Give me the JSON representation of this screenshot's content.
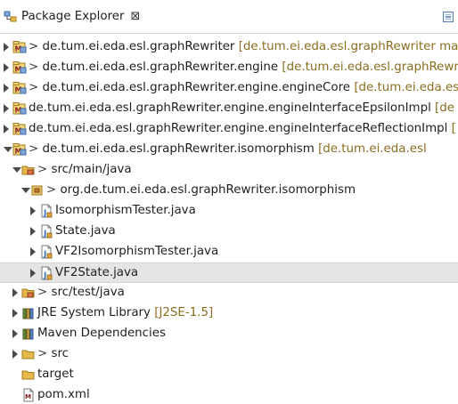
{
  "view": {
    "title": "Package Explorer",
    "close_glyph": "⊠",
    "collapse_icon": "collapse-all-icon"
  },
  "tree": [
    {
      "kind": "project",
      "arrow": "right",
      "prefix": "> ",
      "label": "de.tum.ei.eda.esl.graphRewriter",
      "deco": "[de.tum.ei.eda.esl.graphRewriter ma",
      "icon": "maven-project-icon"
    },
    {
      "kind": "project",
      "arrow": "right",
      "prefix": "> ",
      "label": "de.tum.ei.eda.esl.graphRewriter.engine",
      "deco": "[de.tum.ei.eda.esl.graphRewri",
      "icon": "maven-project-icon"
    },
    {
      "kind": "project",
      "arrow": "right",
      "prefix": "> ",
      "label": "de.tum.ei.eda.esl.graphRewriter.engine.engineCore",
      "deco": "[de.tum.ei.eda.esl",
      "icon": "maven-project-icon"
    },
    {
      "kind": "project",
      "arrow": "right",
      "prefix": "",
      "label": "de.tum.ei.eda.esl.graphRewriter.engine.engineInterfaceEpsilonImpl",
      "deco": "[de",
      "icon": "maven-project-icon"
    },
    {
      "kind": "project",
      "arrow": "right",
      "prefix": "",
      "label": "de.tum.ei.eda.esl.graphRewriter.engine.engineInterfaceReflectionImpl",
      "deco": "[",
      "icon": "maven-project-icon"
    },
    {
      "kind": "project",
      "arrow": "down",
      "prefix": "> ",
      "label": "de.tum.ei.eda.esl.graphRewriter.isomorphism",
      "deco": "[de.tum.ei.eda.esl",
      "icon": "maven-project-icon"
    },
    {
      "kind": "source-folder",
      "arrow": "down",
      "prefix": "> ",
      "label": "src/main/java",
      "deco": "",
      "icon": "source-folder-icon"
    },
    {
      "kind": "package",
      "arrow": "down",
      "prefix": "> ",
      "label": "org.de.tum.ei.eda.esl.graphRewriter.isomorphism",
      "deco": "",
      "icon": "package-icon"
    },
    {
      "kind": "file",
      "arrow": "right",
      "prefix": "",
      "label": "IsomorphismTester.java",
      "deco": "",
      "icon": "java-file-icon"
    },
    {
      "kind": "file",
      "arrow": "right",
      "prefix": "",
      "label": "State.java",
      "deco": "",
      "icon": "java-file-icon"
    },
    {
      "kind": "file",
      "arrow": "right",
      "prefix": "",
      "label": "VF2IsomorphismTester.java",
      "deco": "",
      "icon": "java-file-icon"
    },
    {
      "kind": "file",
      "arrow": "right",
      "prefix": "",
      "label": "VF2State.java",
      "deco": "",
      "icon": "java-file-icon",
      "selected": true
    },
    {
      "kind": "source-folder",
      "arrow": "right",
      "prefix": "> ",
      "label": "src/test/java",
      "deco": "",
      "icon": "source-folder-icon"
    },
    {
      "kind": "library",
      "arrow": "right",
      "prefix": "",
      "label": "JRE System Library",
      "deco": "[J2SE-1.5]",
      "icon": "library-icon"
    },
    {
      "kind": "library",
      "arrow": "right",
      "prefix": "",
      "label": "Maven Dependencies",
      "deco": "",
      "icon": "library-icon"
    },
    {
      "kind": "folder",
      "arrow": "right",
      "prefix": "> ",
      "label": "src",
      "deco": "",
      "icon": "folder-icon"
    },
    {
      "kind": "folder",
      "arrow": "none",
      "prefix": "",
      "label": "target",
      "deco": "",
      "icon": "folder-icon"
    },
    {
      "kind": "xml",
      "arrow": "none",
      "prefix": "",
      "label": "pom.xml",
      "deco": "",
      "icon": "xml-file-icon"
    }
  ],
  "colors": {
    "decoration": "#8a6d1e",
    "selection": "#e5e5e5",
    "folder": "#e6b94a",
    "java": "#3a6fb5",
    "jar": "#6b8e3a"
  }
}
